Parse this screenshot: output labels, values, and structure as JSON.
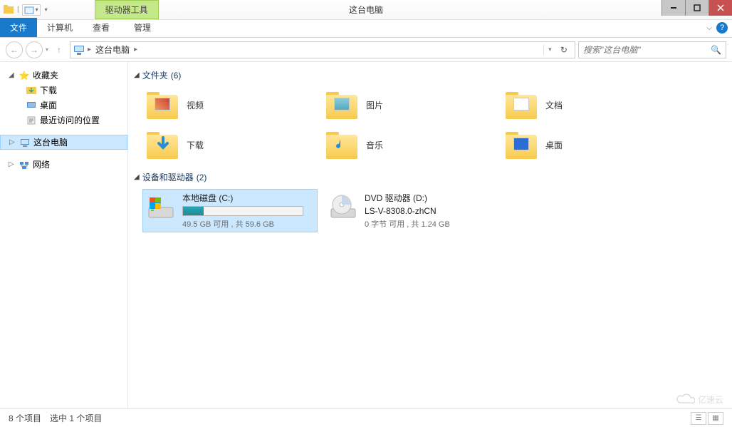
{
  "window": {
    "title": "这台电脑",
    "context_tab": "驱动器工具"
  },
  "ribbon": {
    "file": "文件",
    "computer": "计算机",
    "view": "查看",
    "manage": "管理"
  },
  "nav": {
    "location": "这台电脑",
    "search_placeholder": "搜索\"这台电脑\""
  },
  "sidebar": {
    "favorites": "收藏夹",
    "downloads": "下载",
    "desktop": "桌面",
    "recent": "最近访问的位置",
    "this_pc": "这台电脑",
    "network": "网络"
  },
  "groups": {
    "folders": {
      "label": "文件夹",
      "count": "(6)"
    },
    "devices": {
      "label": "设备和驱动器",
      "count": "(2)"
    }
  },
  "folders": {
    "video": "视频",
    "pictures": "图片",
    "documents": "文档",
    "downloads": "下载",
    "music": "音乐",
    "desktop": "桌面"
  },
  "drives": {
    "c": {
      "name": "本地磁盘 (C:)",
      "detail": "49.5 GB 可用 , 共 59.6 GB",
      "fill_pct": 17
    },
    "d": {
      "name": "DVD 驱动器 (D:)",
      "sub": "LS-V-8308.0-zhCN",
      "detail": "0 字节 可用 , 共 1.24 GB"
    }
  },
  "status": {
    "items": "8 个项目",
    "selected": "选中 1 个项目"
  },
  "watermark": "亿速云"
}
